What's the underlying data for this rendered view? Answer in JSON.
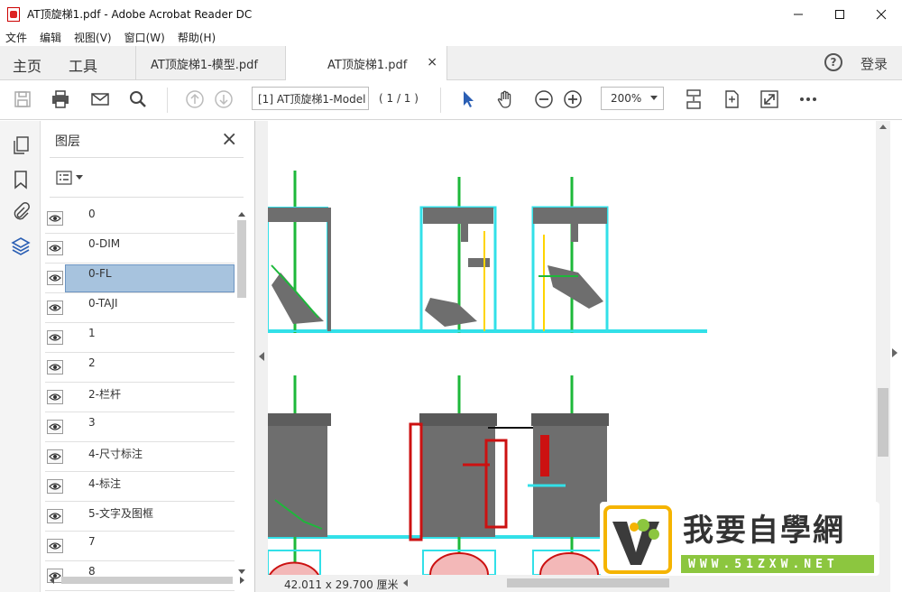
{
  "window": {
    "title": "AT顶旋梯1.pdf - Adobe Acrobat Reader DC"
  },
  "menu": [
    "文件",
    "编辑",
    "视图(V)",
    "窗口(W)",
    "帮助(H)"
  ],
  "nav": {
    "home": "主页",
    "tools": "工具",
    "login": "登录",
    "help": "?"
  },
  "tabs": [
    {
      "label": "AT顶旋梯1-模型.pdf"
    },
    {
      "label": "AT顶旋梯1.pdf",
      "close": "×"
    }
  ],
  "toolbar": {
    "page_field": "[1] AT顶旋梯1-Model",
    "page_count": "( 1 / 1 )",
    "zoom": "200%"
  },
  "panel": {
    "title": "图层",
    "close": "×",
    "layers": [
      {
        "label": "0"
      },
      {
        "label": "0-DIM"
      },
      {
        "label": "0-FL",
        "selected": true
      },
      {
        "label": "0-TAJI"
      },
      {
        "label": "1"
      },
      {
        "label": "2"
      },
      {
        "label": "2-栏杆"
      },
      {
        "label": "3"
      },
      {
        "label": "4-尺寸标注"
      },
      {
        "label": "4-标注"
      },
      {
        "label": "5-文字及图框"
      },
      {
        "label": "7"
      },
      {
        "label": "8"
      }
    ]
  },
  "status": {
    "dimensions": "42.011 x 29.700 厘米"
  },
  "watermark": {
    "title": "我要自學網",
    "url": "WWW.51ZXW.NET"
  },
  "colors": {
    "accent": "#2b5fb4",
    "selection": "#a7c3de",
    "drawing_green": "#1db83a",
    "drawing_cyan": "#32e0e8",
    "drawing_gray": "#6e6e6e",
    "drawing_red": "#cc1111"
  }
}
